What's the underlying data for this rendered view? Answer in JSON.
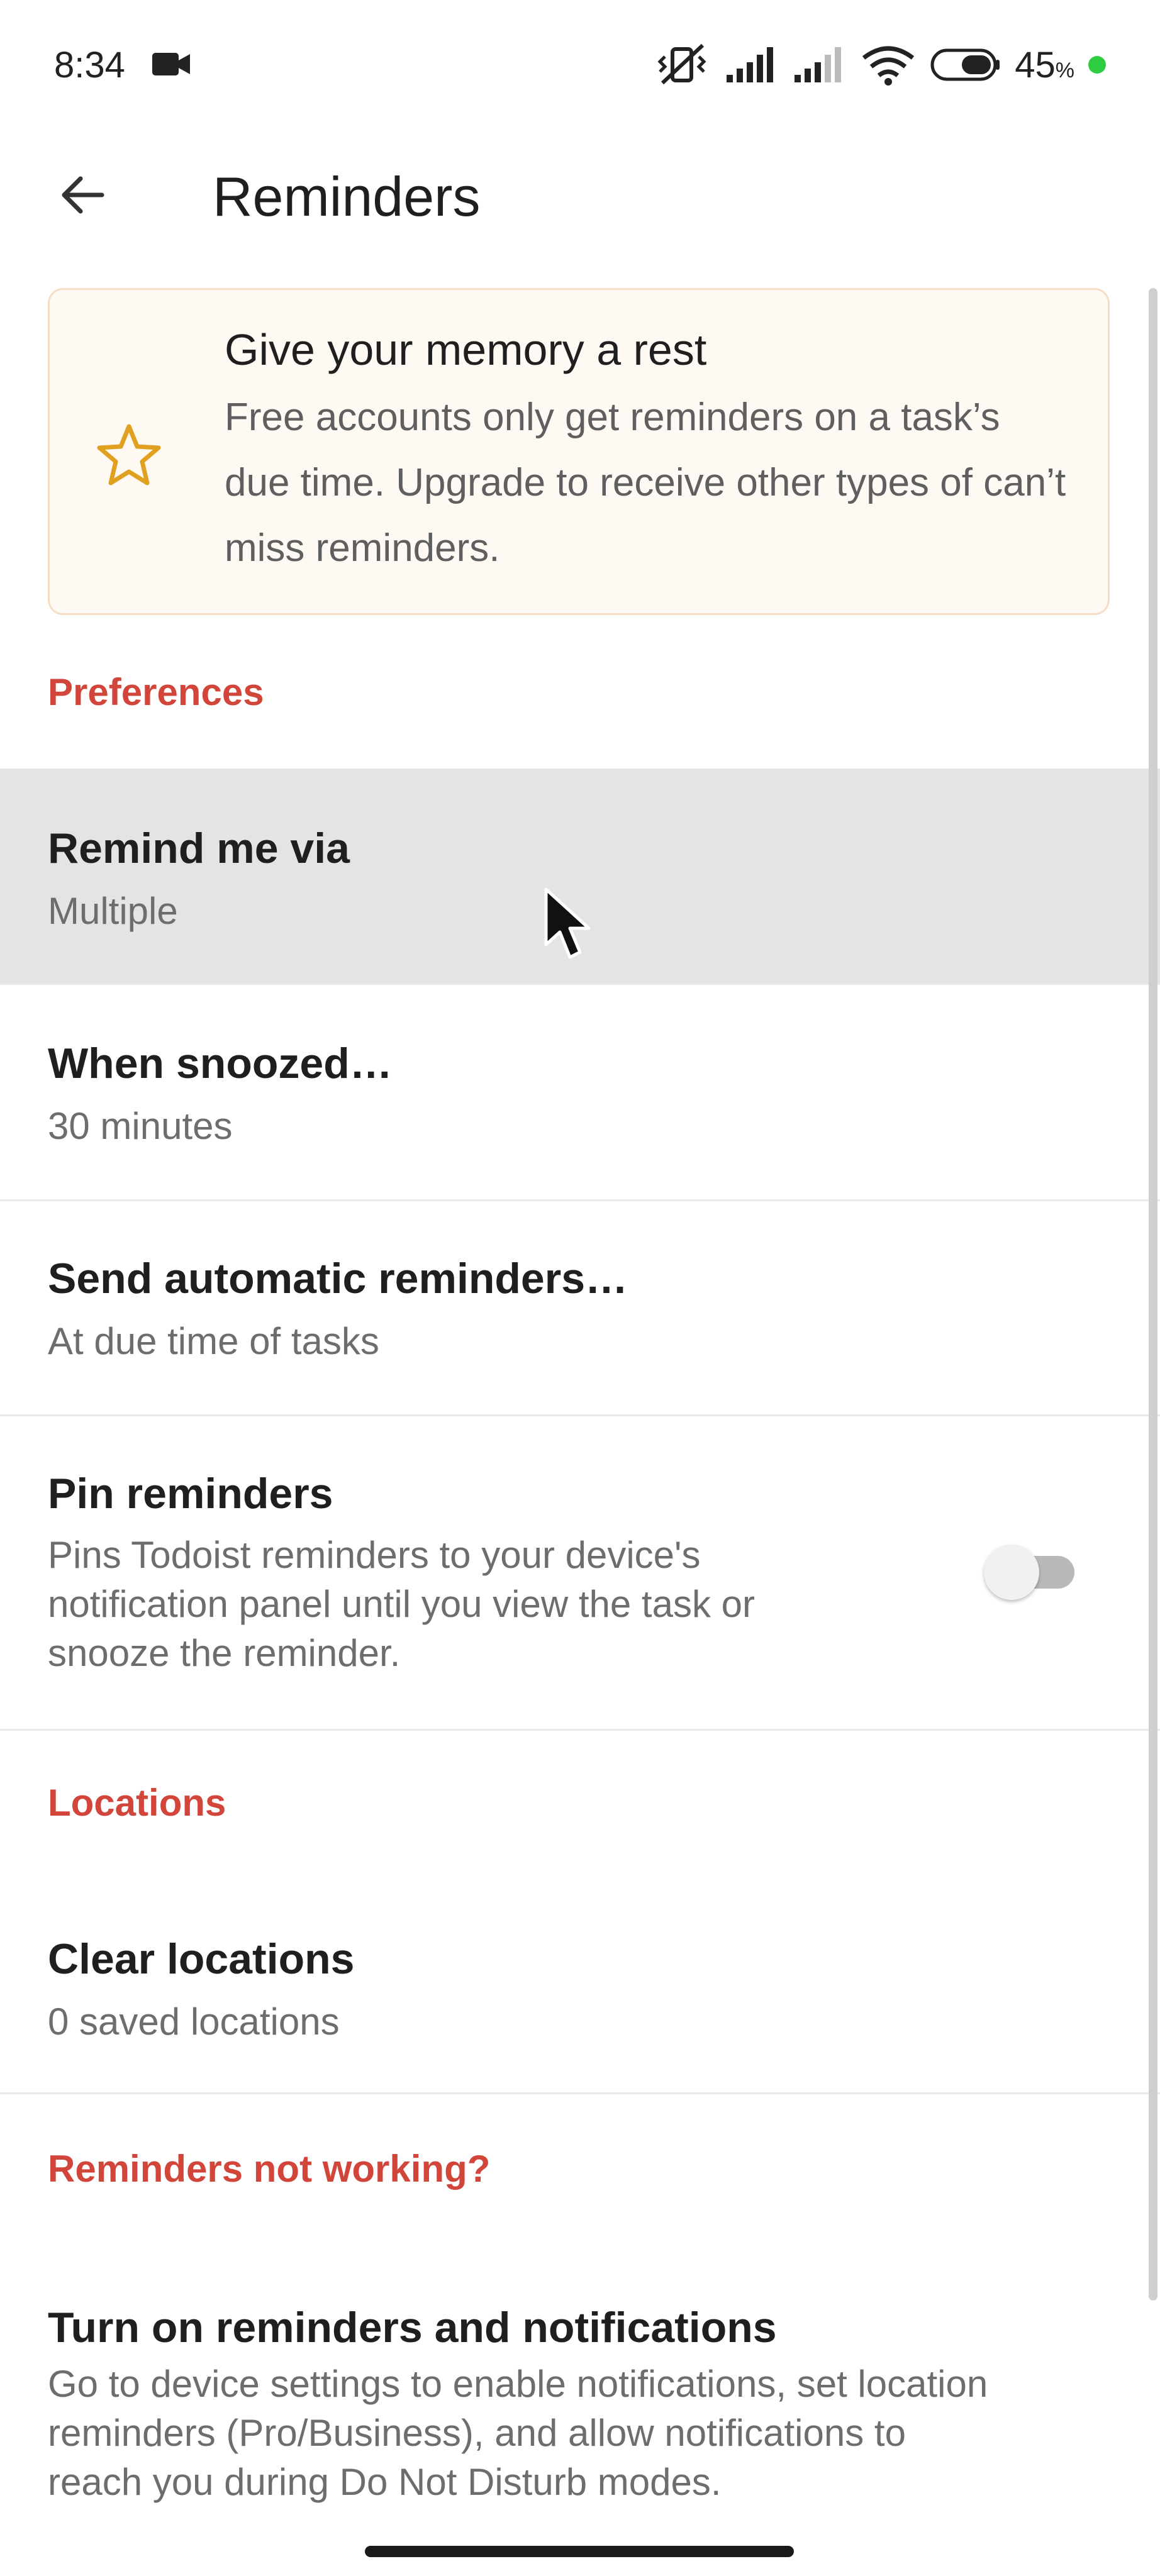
{
  "status_bar": {
    "time": "8:34",
    "battery_percent": "45",
    "battery_unit": "%",
    "icons": [
      "video-camera-icon",
      "vibrate-off-icon",
      "signal-icon",
      "signal-icon",
      "wifi-icon",
      "battery-icon",
      "status-dot"
    ]
  },
  "header": {
    "back_icon": "arrow-left-icon",
    "title": "Reminders"
  },
  "banner": {
    "icon": "star-icon",
    "title": "Give your memory a rest",
    "body": "Free accounts only get reminders on a task’s due time. Upgrade to receive other types of can’t miss reminders."
  },
  "preferences": {
    "header": "Preferences",
    "remind_via": {
      "title": "Remind me via",
      "value": "Multiple"
    },
    "snooze": {
      "title": "When snoozed…",
      "value": "30 minutes"
    },
    "auto_reminders": {
      "title": "Send automatic reminders…",
      "value": "At due time of tasks"
    },
    "pin_reminders": {
      "title": "Pin reminders",
      "description_lines": [
        "Pins Todoist reminders to your device's",
        "notification panel until you view the task or",
        "snooze the reminder."
      ],
      "enabled": false
    }
  },
  "locations": {
    "header": "Locations",
    "clear": {
      "title": "Clear locations",
      "value": "0 saved locations"
    }
  },
  "troubleshoot": {
    "header": "Reminders not working?",
    "turn_on": {
      "title": "Turn on reminders and notifications",
      "description_lines": [
        "Go to device settings to enable notifications, set location",
        "reminders (Pro/Business), and allow notifications to",
        "reach you during Do Not Disturb modes."
      ]
    }
  },
  "colors": {
    "accent": "#d1453b",
    "banner_bg": "#fff9f3",
    "banner_border": "#f6ddc6",
    "star": "#e0a020",
    "highlight_row": "#e4e4e4"
  }
}
